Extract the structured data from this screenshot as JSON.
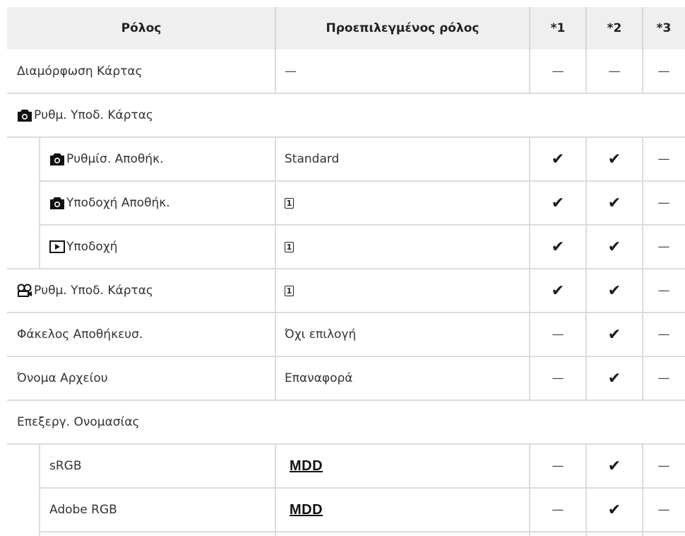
{
  "table": {
    "headers": [
      "Ρόλος",
      "Προεπιλεγμένος ρόλος",
      "*1",
      "*2",
      "*3"
    ],
    "rows": [
      {
        "label": "Διαμόρφωση Κάρτας",
        "default": "—",
        "c1": "—",
        "c2": "—",
        "c3": "—"
      },
      {
        "label": "Ρυθμ. Υποδ. Κάρτας",
        "icon": "camera-icon"
      },
      {
        "label": "Ρυθμίσ. Αποθήκ.",
        "icon": "camera-icon",
        "default": "Standard",
        "c1": "✔",
        "c2": "✔",
        "c3": "—"
      },
      {
        "label": "Υποδοχή Αποθήκ.",
        "icon": "camera-icon",
        "default": "1",
        "default_icon": "card-slot-1-icon",
        "c1": "✔",
        "c2": "✔",
        "c3": "—"
      },
      {
        "label": "Υποδοχή",
        "icon": "playback-icon",
        "default": "1",
        "default_icon": "card-slot-1-icon",
        "c1": "✔",
        "c2": "✔",
        "c3": "—"
      },
      {
        "label": "Ρυθμ. Υποδ. Κάρτας",
        "icon": "movie-camera-icon",
        "default": "1",
        "default_icon": "card-slot-1-icon",
        "c1": "✔",
        "c2": "✔",
        "c3": "—"
      },
      {
        "label": "Φάκελος Αποθήκευσ.",
        "default": "Όχι επιλογή",
        "c1": "—",
        "c2": "✔",
        "c3": "—"
      },
      {
        "label": "Όνομα Αρχείου",
        "default": "Επαναφορά",
        "c1": "—",
        "c2": "✔",
        "c3": "—"
      },
      {
        "label": "Επεξεργ. Ονομασίας"
      },
      {
        "label": "sRGB",
        "default": "MDD",
        "c1": "—",
        "c2": "✔",
        "c3": "—"
      },
      {
        "label": "Adobe RGB",
        "default": "MDD",
        "c1": "—",
        "c2": "✔",
        "c3": "—"
      }
    ]
  }
}
